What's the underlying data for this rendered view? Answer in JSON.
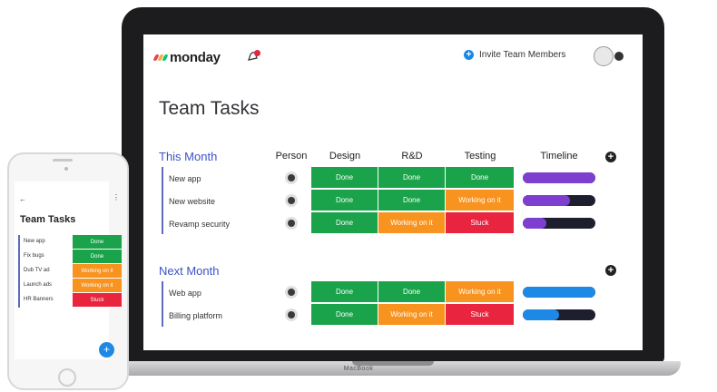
{
  "colors": {
    "done": "#1aa34a",
    "working": "#f7931e",
    "stuck": "#e8243f",
    "accent": "#3b52c9",
    "timeline_purple": "#7e3fd0",
    "timeline_blue": "#1e88e5"
  },
  "app": {
    "brand": "monday",
    "invite_label": "Invite Team Members",
    "icons": [
      "bell-icon",
      "plus-circle-icon",
      "user-avatar"
    ]
  },
  "laptop": {
    "brand": "MacBook"
  },
  "page_title": "Team Tasks",
  "columns": {
    "person": "Person",
    "design": "Design",
    "rd": "R&D",
    "testing": "Testing",
    "timeline": "Timeline"
  },
  "groups": [
    {
      "title": "This Month",
      "rows": [
        {
          "name": "New app",
          "design": "Done",
          "rd": "Done",
          "testing": "Done",
          "timeline_progress": 1.0,
          "timeline_color": "purple"
        },
        {
          "name": "New website",
          "design": "Done",
          "rd": "Done",
          "testing": "Working on it",
          "timeline_progress": 0.65,
          "timeline_color": "purple"
        },
        {
          "name": "Revamp security",
          "design": "Done",
          "rd": "Working on it",
          "testing": "Stuck",
          "timeline_progress": 0.32,
          "timeline_color": "purple"
        }
      ]
    },
    {
      "title": "Next Month",
      "rows": [
        {
          "name": "Web app",
          "design": "Done",
          "rd": "Done",
          "testing": "Working on it",
          "timeline_progress": 1.0,
          "timeline_color": "blue"
        },
        {
          "name": "Billing platform",
          "design": "Done",
          "rd": "Working on it",
          "testing": "Stuck",
          "timeline_progress": 0.5,
          "timeline_color": "blue"
        }
      ]
    }
  ],
  "phone": {
    "title": "Team Tasks",
    "back": "←",
    "more": "⋮",
    "fab": "+",
    "rows": [
      {
        "name": "New app",
        "status": "Done"
      },
      {
        "name": "Fix bugs",
        "status": "Done"
      },
      {
        "name": "Dub TV ad",
        "status": "Working on it"
      },
      {
        "name": "Launch ads",
        "status": "Working on it"
      },
      {
        "name": "HR Banners",
        "status": "Stuck"
      }
    ]
  }
}
